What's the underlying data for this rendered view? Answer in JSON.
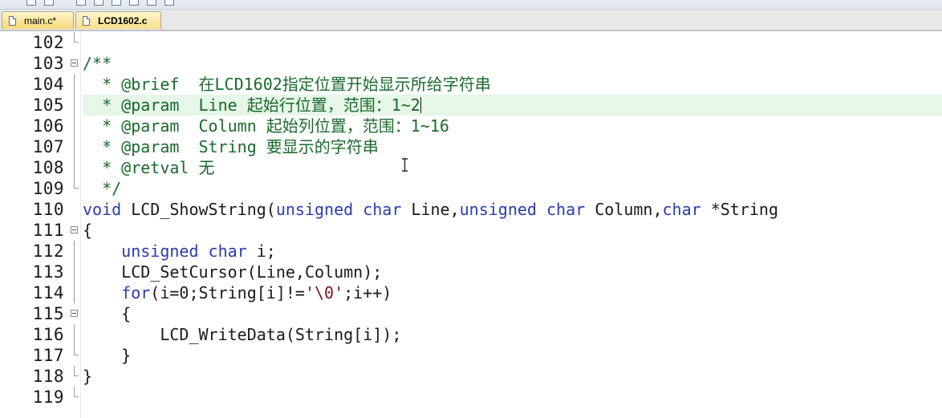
{
  "app": {
    "accent_tab_color": "#f6d97a",
    "current_line_color": "#e6f6e8",
    "comment_color": "#1a6a2c",
    "keyword_color": "#2b3bb0",
    "string_color": "#7a1515"
  },
  "tabs": [
    {
      "label": "main.c*",
      "icon": "file-icon",
      "active": false
    },
    {
      "label": "LCD1602.c",
      "icon": "file-icon",
      "active": true
    }
  ],
  "editor": {
    "current_line": 105,
    "lines": [
      {
        "num": "102",
        "fold": "end",
        "tokens": []
      },
      {
        "num": "103",
        "fold": "open",
        "tokens": [
          {
            "t": "/**",
            "k": "comment"
          }
        ]
      },
      {
        "num": "104",
        "fold": "line",
        "tokens": [
          {
            "t": "  * @brief  在LCD1602指定位置开始显示所给字符串",
            "k": "comment"
          }
        ]
      },
      {
        "num": "105",
        "fold": "line",
        "tokens": [
          {
            "t": "  * @param  Line 起始行位置，范围：1~2",
            "k": "comment"
          }
        ]
      },
      {
        "num": "106",
        "fold": "line",
        "tokens": [
          {
            "t": "  * @param  Column 起始列位置，范围：1~16",
            "k": "comment"
          }
        ]
      },
      {
        "num": "107",
        "fold": "line",
        "tokens": [
          {
            "t": "  * @param  String 要显示的字符串",
            "k": "comment"
          }
        ]
      },
      {
        "num": "108",
        "fold": "line",
        "tokens": [
          {
            "t": "  * @retval 无",
            "k": "comment"
          }
        ]
      },
      {
        "num": "109",
        "fold": "end",
        "tokens": [
          {
            "t": "  */",
            "k": "comment"
          }
        ]
      },
      {
        "num": "110",
        "fold": "none",
        "tokens": [
          {
            "t": "void",
            "k": "keyword"
          },
          {
            "t": " LCD_ShowString(",
            "k": "plain"
          },
          {
            "t": "unsigned",
            "k": "keyword"
          },
          {
            "t": " ",
            "k": "plain"
          },
          {
            "t": "char",
            "k": "keyword"
          },
          {
            "t": " Line,",
            "k": "plain"
          },
          {
            "t": "unsigned",
            "k": "keyword"
          },
          {
            "t": " ",
            "k": "plain"
          },
          {
            "t": "char",
            "k": "keyword"
          },
          {
            "t": " Column,",
            "k": "plain"
          },
          {
            "t": "char",
            "k": "keyword"
          },
          {
            "t": " *String",
            "k": "plain"
          }
        ]
      },
      {
        "num": "111",
        "fold": "open",
        "tokens": [
          {
            "t": "{",
            "k": "plain"
          }
        ]
      },
      {
        "num": "112",
        "fold": "line",
        "tokens": [
          {
            "t": "    ",
            "k": "plain"
          },
          {
            "t": "unsigned",
            "k": "keyword"
          },
          {
            "t": " ",
            "k": "plain"
          },
          {
            "t": "char",
            "k": "keyword"
          },
          {
            "t": " i;",
            "k": "plain"
          }
        ]
      },
      {
        "num": "113",
        "fold": "line",
        "tokens": [
          {
            "t": "    LCD_SetCursor(Line,Column);",
            "k": "plain"
          }
        ]
      },
      {
        "num": "114",
        "fold": "line",
        "tokens": [
          {
            "t": "    ",
            "k": "plain"
          },
          {
            "t": "for",
            "k": "keyword"
          },
          {
            "t": "(i=0;String[i]!=",
            "k": "plain"
          },
          {
            "t": "'\\0'",
            "k": "string"
          },
          {
            "t": ";i++)",
            "k": "plain"
          }
        ]
      },
      {
        "num": "115",
        "fold": "open",
        "tokens": [
          {
            "t": "    {",
            "k": "plain"
          }
        ]
      },
      {
        "num": "116",
        "fold": "line",
        "tokens": [
          {
            "t": "        LCD_WriteData(String[i]);",
            "k": "plain"
          }
        ]
      },
      {
        "num": "117",
        "fold": "end",
        "tokens": [
          {
            "t": "    }",
            "k": "plain"
          }
        ]
      },
      {
        "num": "118",
        "fold": "end",
        "tokens": [
          {
            "t": "}",
            "k": "plain"
          }
        ]
      },
      {
        "num": "119",
        "fold": "end",
        "tokens": []
      }
    ]
  }
}
